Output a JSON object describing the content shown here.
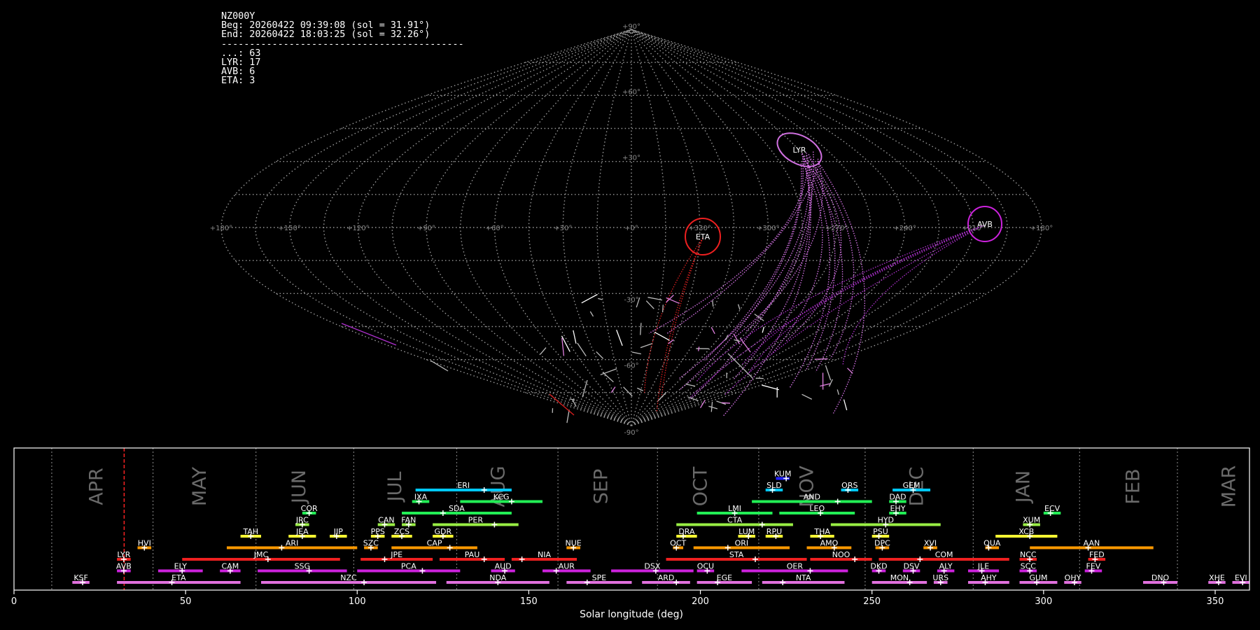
{
  "header": {
    "station": "NZ000Y",
    "begin": "Beg: 20260422 09:39:08 (sol = 31.91°)",
    "end": "End: 20260422 18:03:25 (sol = 32.26°)",
    "separator": "-------------------------------------------",
    "counts": [
      "...: 63",
      "LYR: 17",
      "AVB: 6",
      "ETA: 3"
    ]
  },
  "colors": {
    "red": "#ee2020",
    "orange": "#ff9900",
    "yellow": "#ffff33",
    "lime": "#99ee44",
    "green": "#22ee55",
    "cyan": "#00c8ff",
    "magenta": "#cc22dd",
    "pink": "#e070dd",
    "blue": "#2222ff",
    "grid": "#9a9a9a",
    "month": "#6a6a6a"
  },
  "skymap": {
    "lon_ticks": [
      "+180°",
      "+150°",
      "+120°",
      "+90°",
      "+60°",
      "+30°",
      "+0°",
      "+330°",
      "+300°",
      "+270°",
      "+240°",
      "+210°",
      "+180°"
    ],
    "lat_ticks": [
      "+90°",
      "+60°",
      "+30°",
      "-30°",
      "-60°",
      "-90°"
    ],
    "radiants": [
      {
        "code": "LYR",
        "color": "#d070e0"
      },
      {
        "code": "AVB",
        "color": "#cc22dd"
      },
      {
        "code": "ETA",
        "color": "#ee2020"
      }
    ]
  },
  "chart_data": {
    "type": "timeline",
    "xlabel": "Solar longitude (deg)",
    "xlim": [
      0,
      360
    ],
    "xticks": [
      0,
      50,
      100,
      150,
      200,
      250,
      300,
      350
    ],
    "current_sol": 32.1,
    "months": [
      {
        "name": "APR",
        "sol": 24
      },
      {
        "name": "MAY",
        "sol": 54
      },
      {
        "name": "JUN",
        "sol": 83
      },
      {
        "name": "JUL",
        "sol": 111
      },
      {
        "name": "AUG",
        "sol": 141
      },
      {
        "name": "SEP",
        "sol": 171
      },
      {
        "name": "OCT",
        "sol": 200
      },
      {
        "name": "NOV",
        "sol": 231
      },
      {
        "name": "DEC",
        "sol": 263
      },
      {
        "name": "JAN",
        "sol": 294
      },
      {
        "name": "FEB",
        "sol": 326
      },
      {
        "name": "MAR",
        "sol": 354
      }
    ],
    "month_boundaries": [
      11,
      40.5,
      70.5,
      99,
      129,
      158.5,
      187.5,
      217,
      248,
      279.5,
      310.5,
      339
    ],
    "showers": [
      {
        "code": "KSF",
        "start": 17,
        "end": 22,
        "peak": 20,
        "row": 0,
        "color": "pink"
      },
      {
        "code": "ETA",
        "start": 30,
        "end": 66,
        "peak": 46,
        "row": 0,
        "color": "pink"
      },
      {
        "code": "NZC",
        "start": 72,
        "end": 123,
        "peak": 102,
        "row": 0,
        "color": "pink"
      },
      {
        "code": "NDA",
        "start": 126,
        "end": 156,
        "peak": 141,
        "row": 0,
        "color": "pink"
      },
      {
        "code": "SPE",
        "start": 161,
        "end": 180,
        "peak": 167,
        "row": 0,
        "color": "pink"
      },
      {
        "code": "ARD",
        "start": 183,
        "end": 197,
        "peak": 193,
        "row": 0,
        "color": "pink"
      },
      {
        "code": "EGE",
        "start": 199,
        "end": 215,
        "peak": 205,
        "row": 0,
        "color": "pink"
      },
      {
        "code": "NTA",
        "start": 218,
        "end": 242,
        "peak": 224,
        "row": 0,
        "color": "pink"
      },
      {
        "code": "MON",
        "start": 250,
        "end": 266,
        "peak": 261,
        "row": 0,
        "color": "pink"
      },
      {
        "code": "URS",
        "start": 268,
        "end": 272,
        "peak": 270,
        "row": 0,
        "color": "pink"
      },
      {
        "code": "AHY",
        "start": 278,
        "end": 290,
        "peak": 283,
        "row": 0,
        "color": "pink"
      },
      {
        "code": "GUM",
        "start": 293,
        "end": 304,
        "peak": 298,
        "row": 0,
        "color": "pink"
      },
      {
        "code": "OHY",
        "start": 306,
        "end": 311,
        "peak": 309,
        "row": 0,
        "color": "pink"
      },
      {
        "code": "DNO",
        "start": 329,
        "end": 339,
        "peak": 335,
        "row": 0,
        "color": "pink"
      },
      {
        "code": "XHE",
        "start": 348,
        "end": 353,
        "peak": 351,
        "row": 0,
        "color": "pink"
      },
      {
        "code": "EVI",
        "start": 355,
        "end": 360,
        "peak": 358,
        "row": 0,
        "color": "pink"
      },
      {
        "code": "AVB",
        "start": 30,
        "end": 34,
        "peak": 32,
        "row": 1,
        "color": "magenta"
      },
      {
        "code": "ELY",
        "start": 42,
        "end": 55,
        "peak": 49,
        "row": 1,
        "color": "magenta"
      },
      {
        "code": "CAM",
        "start": 60,
        "end": 66,
        "peak": 63,
        "row": 1,
        "color": "magenta"
      },
      {
        "code": "SSG",
        "start": 71,
        "end": 97,
        "peak": 86,
        "row": 1,
        "color": "magenta"
      },
      {
        "code": "PCA",
        "start": 100,
        "end": 130,
        "peak": 119,
        "row": 1,
        "color": "magenta"
      },
      {
        "code": "AUD",
        "start": 139,
        "end": 146,
        "peak": 143,
        "row": 1,
        "color": "magenta"
      },
      {
        "code": "AUR",
        "start": 154,
        "end": 168,
        "peak": 158,
        "row": 1,
        "color": "magenta"
      },
      {
        "code": "DSX",
        "start": 174,
        "end": 198,
        "peak": 187,
        "row": 1,
        "color": "magenta"
      },
      {
        "code": "OCU",
        "start": 199,
        "end": 204,
        "peak": 202,
        "row": 1,
        "color": "magenta"
      },
      {
        "code": "OER",
        "start": 212,
        "end": 243,
        "peak": 232,
        "row": 1,
        "color": "magenta"
      },
      {
        "code": "DKD",
        "start": 250,
        "end": 254,
        "peak": 252,
        "row": 1,
        "color": "magenta"
      },
      {
        "code": "DSV",
        "start": 259,
        "end": 264,
        "peak": 262,
        "row": 1,
        "color": "magenta"
      },
      {
        "code": "ALY",
        "start": 269,
        "end": 274,
        "peak": 271,
        "row": 1,
        "color": "magenta"
      },
      {
        "code": "JLE",
        "start": 278,
        "end": 287,
        "peak": 282,
        "row": 1,
        "color": "magenta"
      },
      {
        "code": "SCC",
        "start": 293,
        "end": 298,
        "peak": 296,
        "row": 1,
        "color": "magenta"
      },
      {
        "code": "FEV",
        "start": 312,
        "end": 317,
        "peak": 314,
        "row": 1,
        "color": "magenta"
      },
      {
        "code": "LYR",
        "start": 30,
        "end": 34,
        "peak": 32,
        "row": 2,
        "color": "red"
      },
      {
        "code": "JMC",
        "start": 49,
        "end": 95,
        "peak": 74,
        "row": 2,
        "color": "red"
      },
      {
        "code": "JPE",
        "start": 101,
        "end": 122,
        "peak": 108,
        "row": 2,
        "color": "red"
      },
      {
        "code": "PAU",
        "start": 124,
        "end": 143,
        "peak": 137,
        "row": 2,
        "color": "red"
      },
      {
        "code": "NIA",
        "start": 145,
        "end": 164,
        "peak": 148,
        "row": 2,
        "color": "red"
      },
      {
        "code": "STA",
        "start": 190,
        "end": 231,
        "peak": 216,
        "row": 2,
        "color": "red"
      },
      {
        "code": "NOO",
        "start": 232,
        "end": 250,
        "peak": 245,
        "row": 2,
        "color": "red"
      },
      {
        "code": "COM",
        "start": 252,
        "end": 290,
        "peak": 264,
        "row": 2,
        "color": "red"
      },
      {
        "code": "NCC",
        "start": 293,
        "end": 298,
        "peak": 296,
        "row": 2,
        "color": "red"
      },
      {
        "code": "FED",
        "start": 313,
        "end": 318,
        "peak": 315,
        "row": 2,
        "color": "red"
      },
      {
        "code": "HVI",
        "start": 36,
        "end": 40,
        "peak": 38,
        "row": 3,
        "color": "orange"
      },
      {
        "code": "ARI",
        "start": 62,
        "end": 100,
        "peak": 78,
        "row": 3,
        "color": "orange"
      },
      {
        "code": "SZC",
        "start": 102,
        "end": 106,
        "peak": 104,
        "row": 3,
        "color": "orange"
      },
      {
        "code": "CAP",
        "start": 110,
        "end": 135,
        "peak": 127,
        "row": 3,
        "color": "orange"
      },
      {
        "code": "NUE",
        "start": 161,
        "end": 165,
        "peak": 163,
        "row": 3,
        "color": "orange"
      },
      {
        "code": "OCT",
        "start": 192,
        "end": 195,
        "peak": 193,
        "row": 3,
        "color": "orange"
      },
      {
        "code": "ORI",
        "start": 198,
        "end": 226,
        "peak": 208,
        "row": 3,
        "color": "orange"
      },
      {
        "code": "AMO",
        "start": 231,
        "end": 244,
        "peak": 239,
        "row": 3,
        "color": "orange"
      },
      {
        "code": "DPC",
        "start": 251,
        "end": 255,
        "peak": 253,
        "row": 3,
        "color": "orange"
      },
      {
        "code": "XVI",
        "start": 265,
        "end": 269,
        "peak": 267,
        "row": 3,
        "color": "orange"
      },
      {
        "code": "QUA",
        "start": 283,
        "end": 287,
        "peak": 284,
        "row": 3,
        "color": "orange"
      },
      {
        "code": "AAN",
        "start": 296,
        "end": 332,
        "peak": 313,
        "row": 3,
        "color": "orange"
      },
      {
        "code": "TAH",
        "start": 66,
        "end": 72,
        "peak": 69,
        "row": 4,
        "color": "yellow"
      },
      {
        "code": "JEA",
        "start": 80,
        "end": 88,
        "peak": 84,
        "row": 4,
        "color": "yellow"
      },
      {
        "code": "JIP",
        "start": 92,
        "end": 97,
        "peak": 94,
        "row": 4,
        "color": "yellow"
      },
      {
        "code": "PPS",
        "start": 104,
        "end": 108,
        "peak": 106,
        "row": 4,
        "color": "yellow"
      },
      {
        "code": "ZCS",
        "start": 110,
        "end": 116,
        "peak": 113,
        "row": 4,
        "color": "yellow"
      },
      {
        "code": "GDR",
        "start": 122,
        "end": 128,
        "peak": 125,
        "row": 4,
        "color": "yellow"
      },
      {
        "code": "DRA",
        "start": 193,
        "end": 199,
        "peak": 195,
        "row": 4,
        "color": "yellow"
      },
      {
        "code": "LUM",
        "start": 211,
        "end": 216,
        "peak": 214,
        "row": 4,
        "color": "yellow"
      },
      {
        "code": "RPU",
        "start": 219,
        "end": 224,
        "peak": 222,
        "row": 4,
        "color": "yellow"
      },
      {
        "code": "THA",
        "start": 232,
        "end": 239,
        "peak": 235,
        "row": 4,
        "color": "yellow"
      },
      {
        "code": "PSU",
        "start": 250,
        "end": 255,
        "peak": 252,
        "row": 4,
        "color": "yellow"
      },
      {
        "code": "XCB",
        "start": 286,
        "end": 304,
        "peak": 296,
        "row": 4,
        "color": "yellow"
      },
      {
        "code": "JRC",
        "start": 82,
        "end": 86,
        "peak": 84,
        "row": 5,
        "color": "lime"
      },
      {
        "code": "CAN",
        "start": 106,
        "end": 111,
        "peak": 108,
        "row": 5,
        "color": "lime"
      },
      {
        "code": "FAN",
        "start": 113,
        "end": 117,
        "peak": 115,
        "row": 5,
        "color": "lime"
      },
      {
        "code": "PER",
        "start": 122,
        "end": 147,
        "peak": 140,
        "row": 5,
        "color": "lime"
      },
      {
        "code": "CTA",
        "start": 193,
        "end": 227,
        "peak": 218,
        "row": 5,
        "color": "lime"
      },
      {
        "code": "HYD",
        "start": 238,
        "end": 270,
        "peak": 254,
        "row": 5,
        "color": "lime"
      },
      {
        "code": "XUM",
        "start": 294,
        "end": 299,
        "peak": 296,
        "row": 5,
        "color": "lime"
      },
      {
        "code": "COR",
        "start": 84,
        "end": 88,
        "peak": 86,
        "row": 6,
        "color": "green"
      },
      {
        "code": "SDA",
        "start": 113,
        "end": 145,
        "peak": 125,
        "row": 6,
        "color": "green"
      },
      {
        "code": "LMI",
        "start": 199,
        "end": 221,
        "peak": 210,
        "row": 6,
        "color": "green"
      },
      {
        "code": "LEO",
        "start": 223,
        "end": 245,
        "peak": 235,
        "row": 6,
        "color": "green"
      },
      {
        "code": "EHY",
        "start": 255,
        "end": 260,
        "peak": 257,
        "row": 6,
        "color": "green"
      },
      {
        "code": "ECV",
        "start": 300,
        "end": 305,
        "peak": 302,
        "row": 6,
        "color": "green"
      },
      {
        "code": "IXA",
        "start": 116,
        "end": 121,
        "peak": 118,
        "row": 7,
        "color": "green"
      },
      {
        "code": "KCG",
        "start": 130,
        "end": 154,
        "peak": 145,
        "row": 7,
        "color": "green"
      },
      {
        "code": "AND",
        "start": 215,
        "end": 250,
        "peak": 240,
        "row": 7,
        "color": "green"
      },
      {
        "code": "DAD",
        "start": 255,
        "end": 260,
        "peak": 257,
        "row": 7,
        "color": "green"
      },
      {
        "code": "ERI",
        "start": 117,
        "end": 145,
        "peak": 137,
        "row": 8,
        "color": "cyan"
      },
      {
        "code": "SLD",
        "start": 219,
        "end": 224,
        "peak": 221,
        "row": 8,
        "color": "cyan"
      },
      {
        "code": "ORS",
        "start": 241,
        "end": 246,
        "peak": 243,
        "row": 8,
        "color": "cyan"
      },
      {
        "code": "GEM",
        "start": 256,
        "end": 267,
        "peak": 262,
        "row": 8,
        "color": "cyan"
      },
      {
        "code": "KUM",
        "start": 222,
        "end": 226,
        "peak": 225,
        "row": 9,
        "color": "blue"
      }
    ]
  }
}
